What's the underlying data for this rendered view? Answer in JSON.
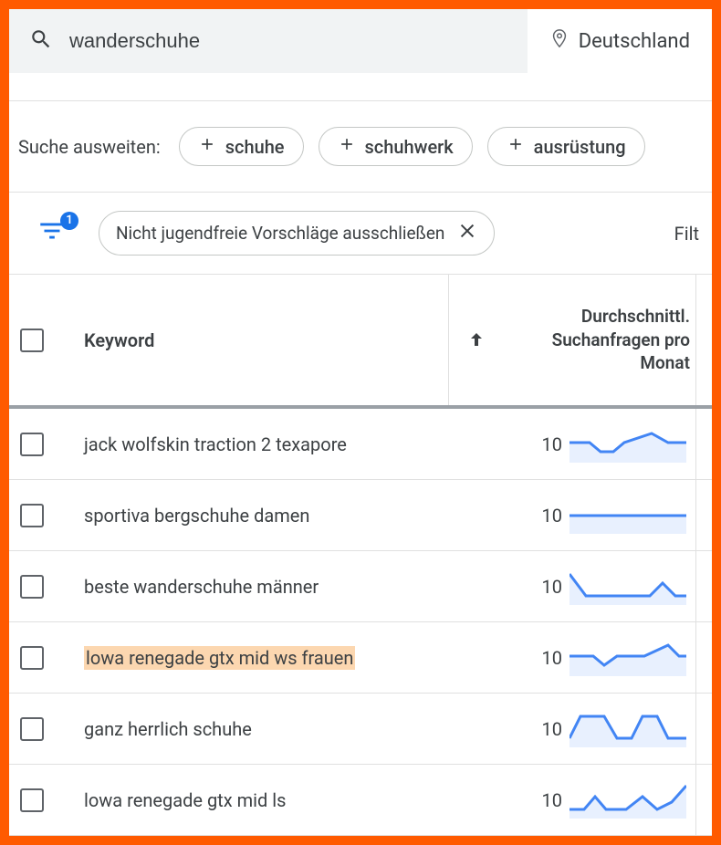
{
  "search": {
    "value": "wanderschuhe"
  },
  "location": {
    "label": "Deutschland"
  },
  "expand": {
    "label": "Suche ausweiten:",
    "items": [
      "schuhe",
      "schuhwerk",
      "ausrüstung"
    ]
  },
  "filters": {
    "count": "1",
    "active_chip": "Nicht jugendfreie Vorschläge ausschließen",
    "right_text": "Filt"
  },
  "table": {
    "headers": {
      "keyword": "Keyword",
      "avg": "Durchschnittl. Suchanfragen pro Monat"
    },
    "rows": [
      {
        "keyword": "jack wolfskin traction 2 texapore",
        "vol": "10",
        "hl": false,
        "spark": "0,18 22,18 34,28 48,28 60,18 90,8 108,18 128,18"
      },
      {
        "keyword": "sportiva bergschuhe damen",
        "vol": "10",
        "hl": false,
        "spark": "0,20 128,20"
      },
      {
        "keyword": "beste wanderschuhe männer",
        "vol": "10",
        "hl": false,
        "spark": "0,6 18,30 50,30 88,30 102,16 116,30 128,30"
      },
      {
        "keyword": "lowa renegade gtx mid ws frauen",
        "vol": "10",
        "hl": true,
        "spark": "0,18 26,18 38,28 52,18 82,18 108,6 120,18 128,18"
      },
      {
        "keyword": "ganz herrlich schuhe",
        "vol": "10",
        "hl": false,
        "spark": "0,30 12,6 38,6 52,30 68,30 80,6 96,6 108,30 128,30"
      },
      {
        "keyword": "lowa renegade gtx mid ls",
        "vol": "10",
        "hl": false,
        "spark": "0,30 16,30 28,16 40,30 62,30 80,16 96,30 112,22 128,4"
      }
    ]
  },
  "colors": {
    "accent": "#1a73e8",
    "spark_stroke": "#4285f4",
    "spark_fill": "#e8f0fe",
    "border": "#ff5a00"
  }
}
